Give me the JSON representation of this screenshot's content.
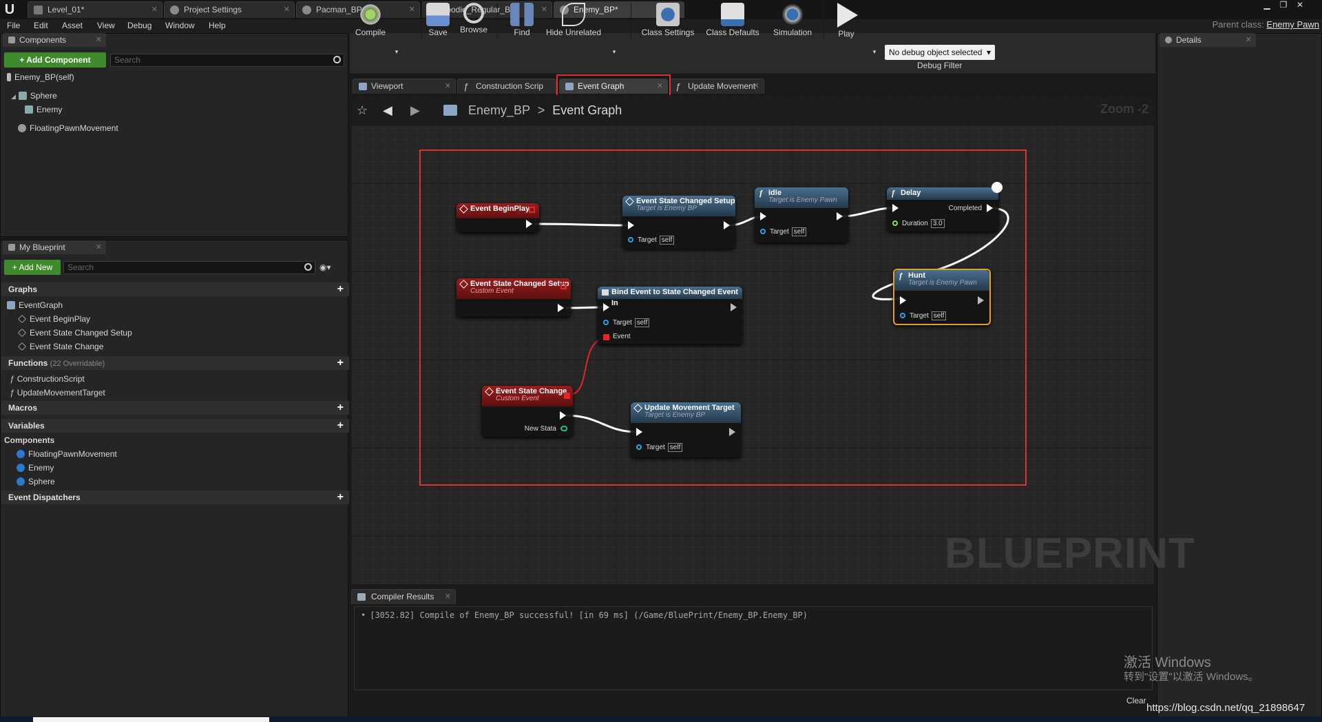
{
  "app": {
    "logo": "U",
    "parent_class_label": "Parent class:",
    "parent_class_value": "Enemy Pawn"
  },
  "doc_tabs": [
    {
      "label": "Level_01*"
    },
    {
      "label": "Project Settings"
    },
    {
      "label": "Pacman_BP"
    },
    {
      "label": "Foodie_Regular_BP"
    },
    {
      "label": "Enemy_BP*"
    }
  ],
  "menu": [
    "File",
    "Edit",
    "Asset",
    "View",
    "Debug",
    "Window",
    "Help"
  ],
  "components_panel": {
    "title": "Components",
    "add_button": "+ Add Component",
    "search_placeholder": "Search",
    "root": "Enemy_BP(self)",
    "items": [
      "Sphere",
      "Enemy",
      "FloatingPawnMovement"
    ]
  },
  "my_blueprint": {
    "title": "My Blueprint",
    "add_new": "+ Add New",
    "search_placeholder": "Search",
    "graphs_label": "Graphs",
    "event_graph": "EventGraph",
    "events": [
      "Event BeginPlay",
      "Event State Changed Setup",
      "Event State Change"
    ],
    "functions_label": "Functions",
    "functions_sub": "(22 Overridable)",
    "functions": [
      "ConstructionScript",
      "UpdateMovementTarget"
    ],
    "macros_label": "Macros",
    "variables_label": "Variables",
    "components_label": "Components",
    "component_vars": [
      "FloatingPawnMovement",
      "Enemy",
      "Sphere"
    ],
    "dispatchers_label": "Event Dispatchers"
  },
  "toolbar": {
    "compile": "Compile",
    "save": "Save",
    "browse": "Browse",
    "find": "Find",
    "hide_unrelated": "Hide Unrelated",
    "class_settings": "Class Settings",
    "class_defaults": "Class Defaults",
    "simulation": "Simulation",
    "play": "Play",
    "debug_select": "No debug object selected",
    "debug_filter": "Debug Filter"
  },
  "editor_tabs": [
    "Viewport",
    "Construction Scrip",
    "Event Graph",
    "Update Movement"
  ],
  "details_title": "Details",
  "graph": {
    "breadcrumb_bp": "Enemy_BP",
    "breadcrumb_sep": ">",
    "breadcrumb_graph": "Event Graph",
    "zoom": "Zoom -2",
    "watermark": "BLUEPRINT",
    "nodes": {
      "begin_play": {
        "title": "Event BeginPlay"
      },
      "state_setup_call": {
        "title": "Event State Changed Setup",
        "sub": "Target is Enemy BP",
        "target": "Target",
        "self": "self"
      },
      "idle": {
        "title": "Idle",
        "sub": "Target is Enemy Pawn",
        "target": "Target",
        "self": "self"
      },
      "delay": {
        "title": "Delay",
        "completed": "Completed",
        "duration": "Duration",
        "duration_value": "3.0"
      },
      "hunt": {
        "title": "Hunt",
        "sub": "Target is Enemy Pawn",
        "target": "Target",
        "self": "self"
      },
      "state_setup_event": {
        "title": "Event State Changed Setup",
        "sub": "Custom Event"
      },
      "bind_event": {
        "title": "Bind Event to State Changed Event In",
        "target": "Target",
        "self": "self",
        "event": "Event"
      },
      "state_change": {
        "title": "Event State Change",
        "sub": "Custom Event",
        "new_state": "New Stata"
      },
      "update_target": {
        "title": "Update Movement Target",
        "sub": "Target is Enemy BP",
        "target": "Target",
        "self": "self"
      }
    }
  },
  "compiler": {
    "tab": "Compiler Results",
    "message": "[3052.82] Compile of Enemy_BP successful! [in 69 ms] (/Game/BluePrint/Enemy_BP.Enemy_BP)",
    "clear": "Clear"
  },
  "windows_notice": {
    "line1": "激活 Windows",
    "line2": "转到\"设置\"以激活 Windows。"
  },
  "watermark_url": "https://blog.csdn.net/qq_21898647",
  "colors": {
    "accent_green": "#3f8a2c",
    "highlight_red": "#e03030",
    "selected_orange": "#e8a21a",
    "event_red": "#9a1d1d",
    "function_blue": "#4a6f8e"
  }
}
